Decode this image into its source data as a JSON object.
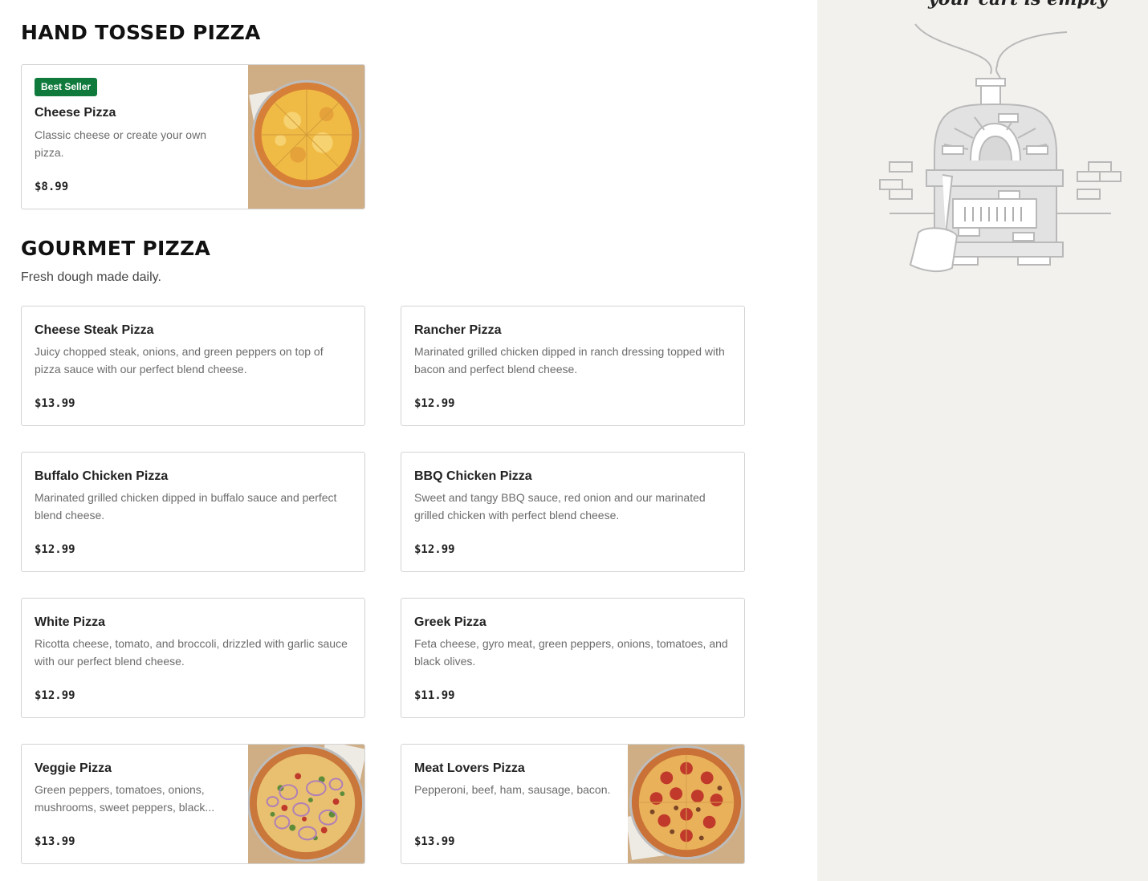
{
  "sections": {
    "hand_tossed": {
      "title": "HAND TOSSED PIZZA",
      "items": [
        {
          "badge": "Best Seller",
          "name": "Cheese Pizza",
          "description": "Classic cheese or create your own pizza.",
          "price": "$8.99",
          "image": "cheese-pizza-image"
        }
      ]
    },
    "gourmet": {
      "title": "GOURMET PIZZA",
      "subtitle": "Fresh dough made daily.",
      "items": [
        {
          "name": "Cheese Steak Pizza",
          "description": "Juicy chopped steak, onions, and green peppers on top of pizza sauce with our perfect blend cheese.",
          "price": "$13.99"
        },
        {
          "name": "Rancher Pizza",
          "description": "Marinated grilled chicken dipped in ranch dressing topped with bacon and perfect blend cheese.",
          "price": "$12.99"
        },
        {
          "name": "Buffalo Chicken Pizza",
          "description": "Marinated grilled chicken dipped in buffalo sauce and perfect blend cheese.",
          "price": "$12.99"
        },
        {
          "name": "BBQ Chicken Pizza",
          "description": "Sweet and tangy BBQ sauce, red onion and our marinated grilled chicken with perfect blend cheese.",
          "price": "$12.99"
        },
        {
          "name": "White Pizza",
          "description": "Ricotta cheese, tomato, and broccoli, drizzled with garlic sauce with our perfect blend cheese.",
          "price": "$12.99"
        },
        {
          "name": "Greek Pizza",
          "description": "Feta cheese, gyro meat, green peppers, onions, tomatoes, and black olives.",
          "price": "$11.99"
        },
        {
          "name": "Veggie Pizza",
          "description": "Green peppers, tomatoes, onions, mushrooms, sweet peppers, black...",
          "price": "$13.99",
          "image": "veggie-pizza-image"
        },
        {
          "name": "Meat Lovers Pizza",
          "description": "Pepperoni, beef, ham, sausage, bacon.",
          "price": "$13.99",
          "image": "meat-lovers-pizza-image"
        }
      ]
    }
  },
  "cart": {
    "empty_message": "your cart is empty",
    "illustration": "pizza-oven-illustration"
  },
  "colors": {
    "badge": "#0f7a3c",
    "cart_background": "#f2f1ee",
    "card_border": "#d3d3d3"
  }
}
